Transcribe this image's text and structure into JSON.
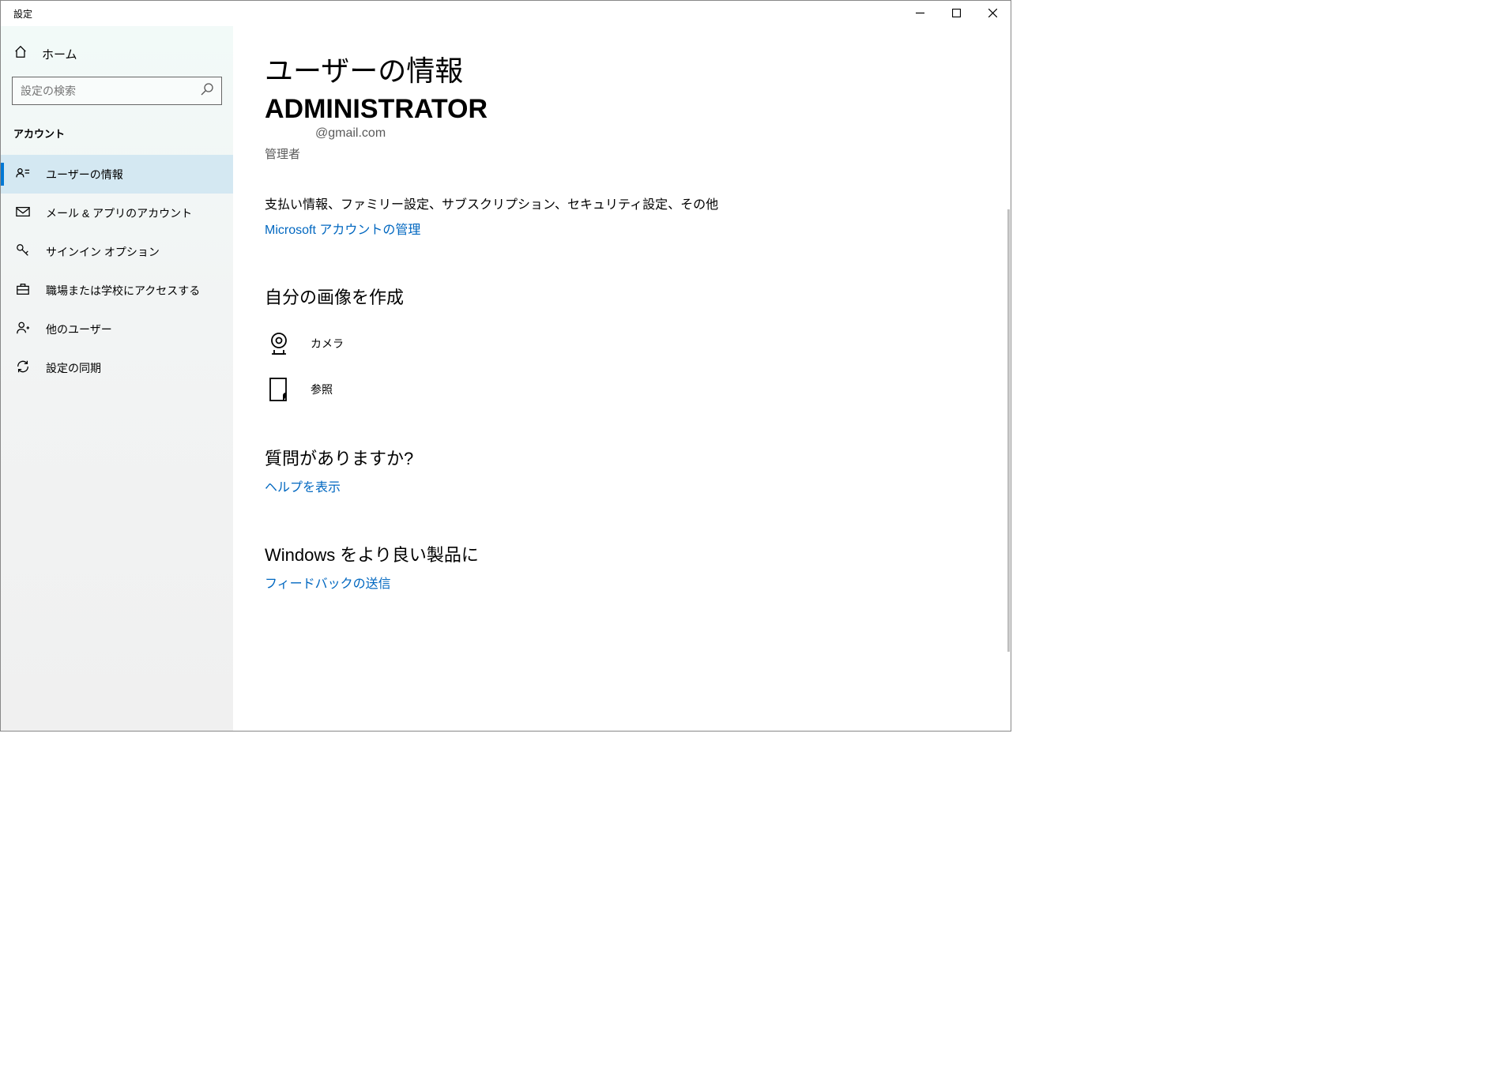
{
  "window": {
    "title": "設定"
  },
  "sidebar": {
    "home": "ホーム",
    "search_placeholder": "設定の検索",
    "category": "アカウント",
    "items": [
      {
        "label": "ユーザーの情報"
      },
      {
        "label": "メール & アプリのアカウント"
      },
      {
        "label": "サインイン オプション"
      },
      {
        "label": "職場または学校にアクセスする"
      },
      {
        "label": "他のユーザー"
      },
      {
        "label": "設定の同期"
      }
    ]
  },
  "content": {
    "heading": "ユーザーの情報",
    "user_name": "ADMINISTRATOR",
    "user_email": "@gmail.com",
    "user_role": "管理者",
    "description": "支払い情報、ファミリー設定、サブスクリプション、セキュリティ設定、その他",
    "manage_link": "Microsoft アカウントの管理",
    "create_picture_heading": "自分の画像を作成",
    "camera_label": "カメラ",
    "browse_label": "参照",
    "question_heading": "質問がありますか?",
    "help_link": "ヘルプを表示",
    "improve_heading": "Windows をより良い製品に",
    "feedback_link": "フィードバックの送信"
  }
}
